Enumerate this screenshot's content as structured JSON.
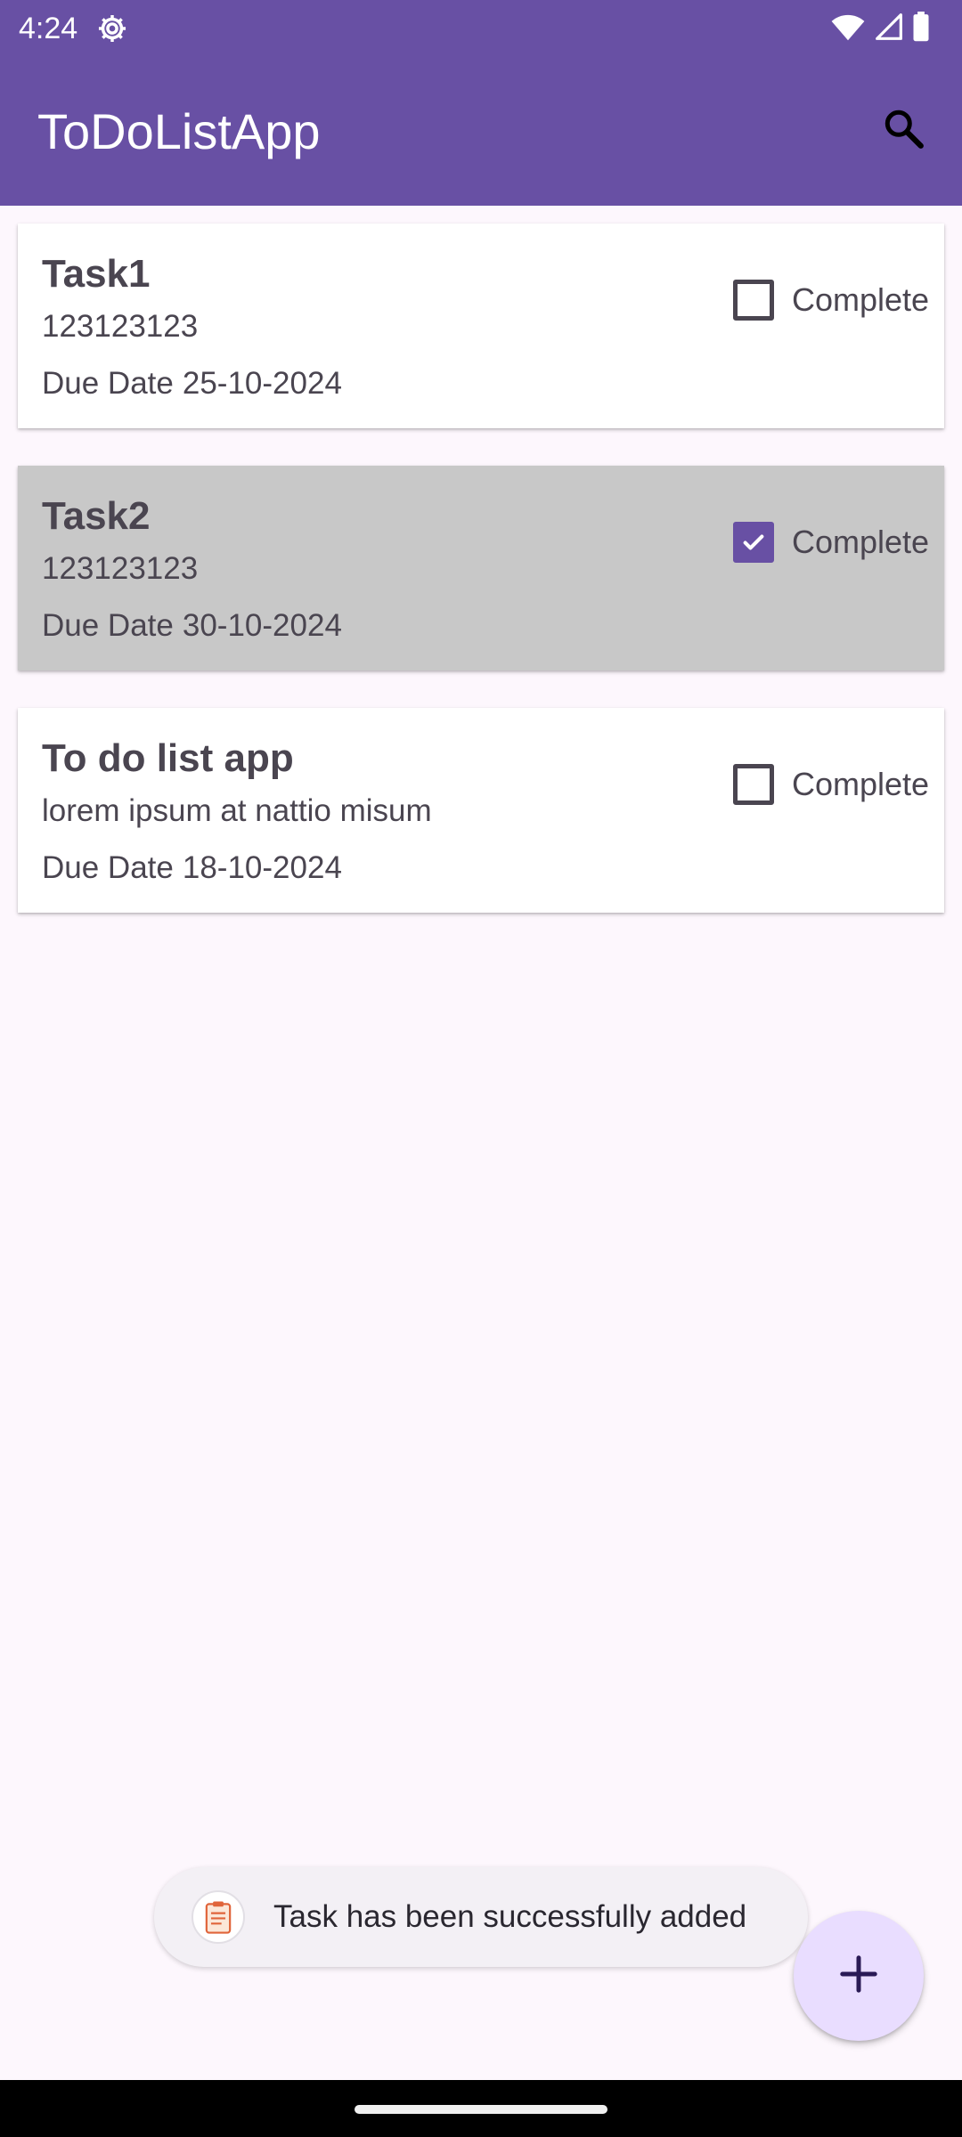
{
  "status_bar": {
    "time": "4:24",
    "icons": [
      "settings-gear-icon",
      "wifi-icon",
      "signal-icon",
      "battery-icon"
    ]
  },
  "app_bar": {
    "title": "ToDoListApp",
    "search_icon": "search-icon"
  },
  "tasks": [
    {
      "title": "Task1",
      "description": "123123123",
      "due_label": "Due Date",
      "due_date": "25-10-2024",
      "complete_label": "Complete",
      "completed": false
    },
    {
      "title": "Task2",
      "description": "123123123",
      "due_label": "Due Date",
      "due_date": "30-10-2024",
      "complete_label": "Complete",
      "completed": true
    },
    {
      "title": "To do list app",
      "description": "lorem ipsum at nattio misum",
      "due_label": "Due Date",
      "due_date": "18-10-2024",
      "complete_label": "Complete",
      "completed": false
    }
  ],
  "toast": {
    "message": "Task has been successfully added",
    "icon": "app-clipboard-icon"
  },
  "fab": {
    "icon": "plus-icon"
  },
  "colors": {
    "primary": "#6850a4",
    "background": "#fdf7fd",
    "completed_card": "#c8c8c8",
    "fab": "#e9ddff"
  }
}
